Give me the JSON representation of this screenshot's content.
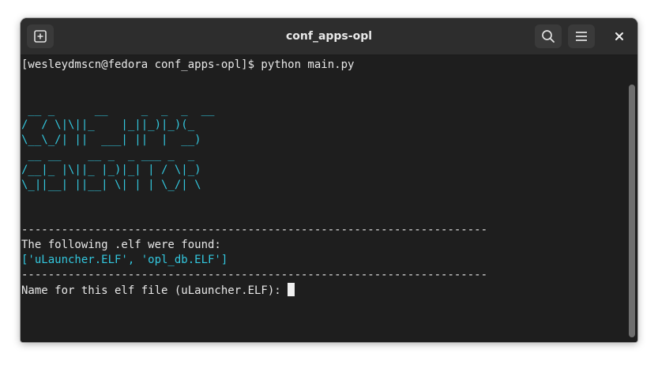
{
  "window": {
    "title": "conf_apps-opl"
  },
  "icons": {
    "new_tab": "new-tab-icon",
    "search": "search-icon",
    "menu": "hamburger-menu-icon",
    "close": "close-icon"
  },
  "colors": {
    "background": "#1e1e1e",
    "titlebar": "#2d2d2d",
    "text": "#e8e8e8",
    "accent_cyan": "#33c7de"
  },
  "terminal": {
    "prompt_line": "[wesleydmscn@fedora conf_apps-opl]$ python main.py",
    "banner": [
      " __ _      __     _  _  _  __",
      "/  / \\|\\||_    |_||_)|_)(_",
      "\\__\\_/| ||  ___| ||  |  __)",
      " __ __    __ _  _ ___ _  _",
      "/__|_ |\\||_ |_)|_| | / \\|_)",
      "\\_||__| ||__| \\| | | \\_/| \\"
    ],
    "separator": "----------------------------------------------------------------------",
    "found_msg": "The following .elf were found:",
    "found_list": "['uLauncher.ELF', 'opl_db.ELF']",
    "input_prompt": "Name for this elf file (uLauncher.ELF): "
  }
}
